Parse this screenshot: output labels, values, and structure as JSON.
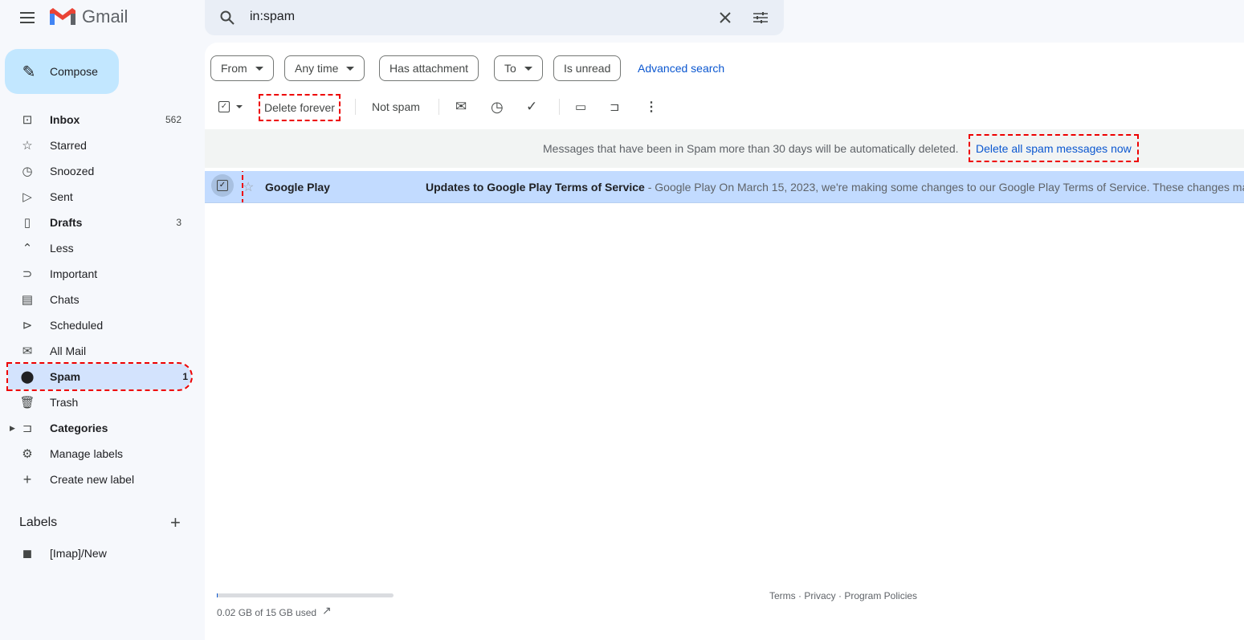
{
  "app": {
    "name": "Gmail"
  },
  "search": {
    "value": "in:spam"
  },
  "compose": {
    "label": "Compose"
  },
  "sidebar": {
    "items": [
      {
        "label": "Inbox",
        "count": "562",
        "icon": "inbox-icon",
        "bold": true
      },
      {
        "label": "Starred",
        "count": "",
        "icon": "star-icon"
      },
      {
        "label": "Snoozed",
        "count": "",
        "icon": "clock-icon"
      },
      {
        "label": "Sent",
        "count": "",
        "icon": "send-icon"
      },
      {
        "label": "Drafts",
        "count": "3",
        "icon": "draft-icon",
        "bold": true
      },
      {
        "label": "Less",
        "count": "",
        "icon": "chevron-up-icon"
      },
      {
        "label": "Important",
        "count": "",
        "icon": "important-icon"
      },
      {
        "label": "Chats",
        "count": "",
        "icon": "chat-icon"
      },
      {
        "label": "Scheduled",
        "count": "",
        "icon": "scheduled-icon"
      },
      {
        "label": "All Mail",
        "count": "",
        "icon": "all-mail-icon"
      },
      {
        "label": "Spam",
        "count": "1",
        "icon": "spam-icon",
        "bold": true,
        "active": true
      },
      {
        "label": "Trash",
        "count": "",
        "icon": "trash-icon"
      },
      {
        "label": "Categories",
        "count": "",
        "icon": "label-icon",
        "bold": true
      },
      {
        "label": "Manage labels",
        "count": "",
        "icon": "gear-icon"
      },
      {
        "label": "Create new label",
        "count": "",
        "icon": "plus-icon"
      }
    ],
    "labels_heading": "Labels",
    "labels": [
      {
        "label": "[Imap]/New"
      }
    ]
  },
  "filters": [
    "From",
    "Any time",
    "Has attachment",
    "To",
    "Is unread"
  ],
  "advanced_search": "Advanced search",
  "toolbar": {
    "delete_forever": "Delete forever",
    "not_spam": "Not spam"
  },
  "banner": {
    "text": "Messages that have been in Spam more than 30 days will be automatically deleted.",
    "link": "Delete all spam messages now"
  },
  "emails": [
    {
      "sender": "Google Play",
      "subject": "Updates to Google Play Terms of Service",
      "snippet": " - Google Play On March 15, 2023, we're making some changes to our Google Play Terms of Service. These changes may affect you",
      "selected": true
    }
  ],
  "footer": {
    "storage": "0.02 GB of 15 GB used",
    "storage_fraction": 0.0013,
    "links": "Terms · Privacy · Program Policies"
  },
  "colors": {
    "accent": "#0b57d0",
    "selected_row": "#c2dbff",
    "compose": "#c2e7ff",
    "active_nav": "#d3e3fd"
  }
}
